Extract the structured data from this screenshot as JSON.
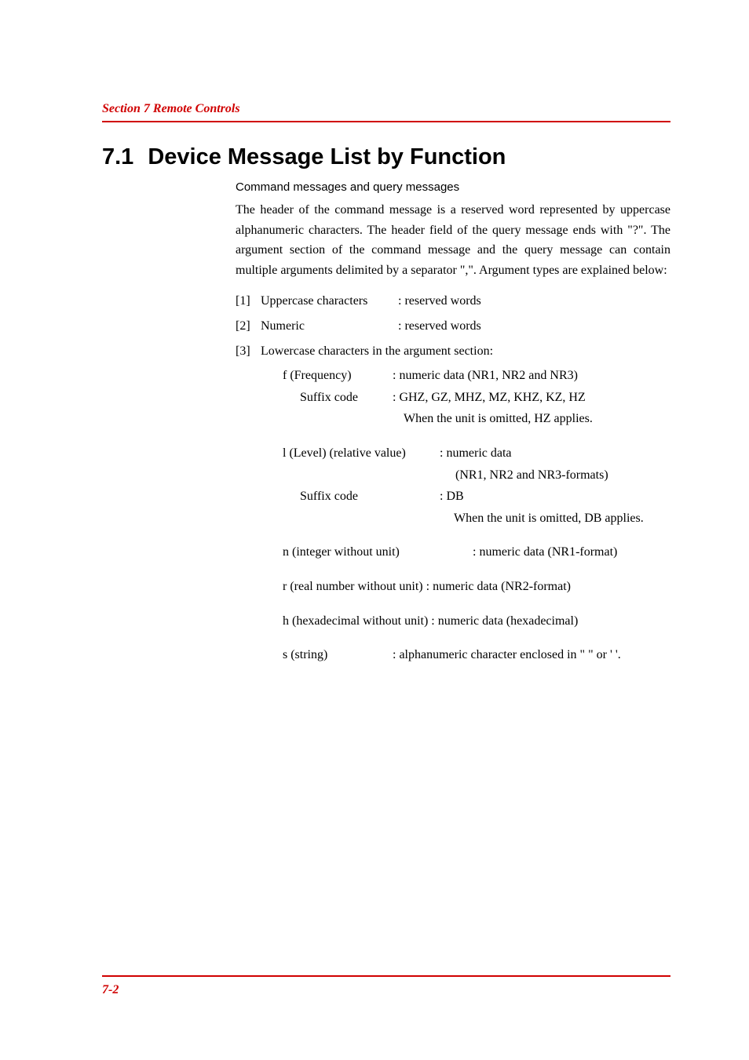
{
  "header": {
    "section": "Section 7   Remote Controls"
  },
  "title": {
    "number": "7.1",
    "text": "Device Message List by Function"
  },
  "subheading": "Command messages and query messages",
  "intro": "The header of the command message is a reserved word represented by uppercase alphanumeric characters.   The header field of the query message ends with \"?\".   The argument section of the command message and the query message can contain multiple arguments delimited by a separator \",\".   Argument types are explained below:",
  "items": [
    {
      "num": "[1]",
      "label": "Uppercase characters",
      "desc": ": reserved words"
    },
    {
      "num": "[2]",
      "label": "Numeric",
      "desc": ": reserved words"
    },
    {
      "num": "[3]",
      "label": "Lowercase characters in the argument section:",
      "desc": ""
    }
  ],
  "freq": {
    "label": "f (Frequency)",
    "desc": ": numeric data (NR1, NR2 and NR3)",
    "suffix_label": "Suffix code",
    "suffix_desc": ": GHZ, GZ, MHZ, MZ, KHZ, KZ, HZ",
    "note": "When the unit is omitted, HZ applies."
  },
  "level": {
    "label": "l (Level) (relative value)",
    "desc": ": numeric data",
    "desc2": "(NR1, NR2 and NR3-formats)",
    "suffix_label": "Suffix code",
    "suffix_desc": ": DB",
    "note": "When the unit is omitted, DB applies."
  },
  "n": {
    "label": "n (integer without unit)",
    "desc": ": numeric data (NR1-format)"
  },
  "r": {
    "text": "r (real number without unit)  : numeric data (NR2-format)"
  },
  "h": {
    "text": "h (hexadecimal without unit) : numeric data (hexadecimal)"
  },
  "s": {
    "label": "s (string)",
    "desc": ": alphanumeric character enclosed in \" \" or ' '."
  },
  "footer": {
    "page": "7-2"
  }
}
